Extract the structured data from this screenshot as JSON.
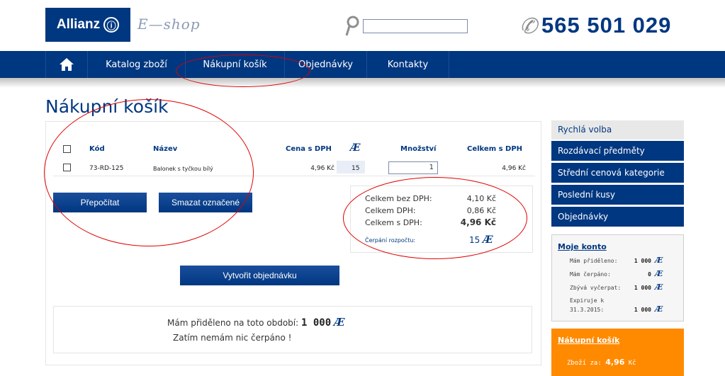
{
  "header": {
    "logo_text": "Allianz",
    "logo_mark": "Ⓘ",
    "shop_name": "E—shop",
    "search_placeholder": "",
    "phone": "565 501 029"
  },
  "nav": {
    "home_icon": "home-icon",
    "items": [
      "Katalog zboží",
      "Nákupní košík",
      "Objednávky",
      "Kontakty"
    ]
  },
  "page_title": "Nákupní košík",
  "cart": {
    "columns": [
      "Kód",
      "Název",
      "Cena s DPH",
      "Æ",
      "Množství",
      "Celkem s DPH"
    ],
    "rows": [
      {
        "code": "73-RD-125",
        "name": "Balonek s tyčkou bílý",
        "price": "4,96 Kč",
        "points": "15",
        "quantity": "1",
        "total": "4,96 Kč"
      }
    ],
    "recalc_label": "Přepočítat",
    "delete_label": "Smazat označené",
    "order_label": "Vytvořit objednávku"
  },
  "totals": {
    "without_vat_label": "Celkem bez DPH:",
    "without_vat": "4,10 Kč",
    "vat_label": "Celkem DPH:",
    "vat": "0,86 Kč",
    "with_vat_label": "Celkem s DPH:",
    "with_vat": "4,96 Kč",
    "budget_label": "Čerpání rozpočtu:",
    "budget_value": "15"
  },
  "info": {
    "allocated_label": "Mám přiděleno na toto období:",
    "allocated_value": "1 000",
    "drawn_text": "Zatím nemám nic čerpáno !"
  },
  "sidebar": {
    "quick_title": "Rychlá volba",
    "items": [
      "Rozdávací předměty",
      "Střední cenová kategorie",
      "Poslední kusy",
      "Objednávky"
    ],
    "account_title": "Moje konto",
    "account_rows": [
      {
        "label": "Mám přiděleno:",
        "value": "1 000"
      },
      {
        "label": "Mám čerpáno:",
        "value": "0"
      },
      {
        "label": "Zbývá vyčerpat:",
        "value": "1 000"
      }
    ],
    "expires_label": "Expiruje k",
    "expires_date": "31.3.2015:",
    "expires_value": "1 000",
    "cart_title": "Nákupní košík",
    "cart_sum_label": "Zboží za:",
    "cart_sum_value": "4,96",
    "cart_sum_unit": "Kč"
  },
  "currency_symbol": "Æ",
  "colors": {
    "brand": "#003781",
    "accent": "#ff8a00",
    "annotation": "#e00000"
  }
}
